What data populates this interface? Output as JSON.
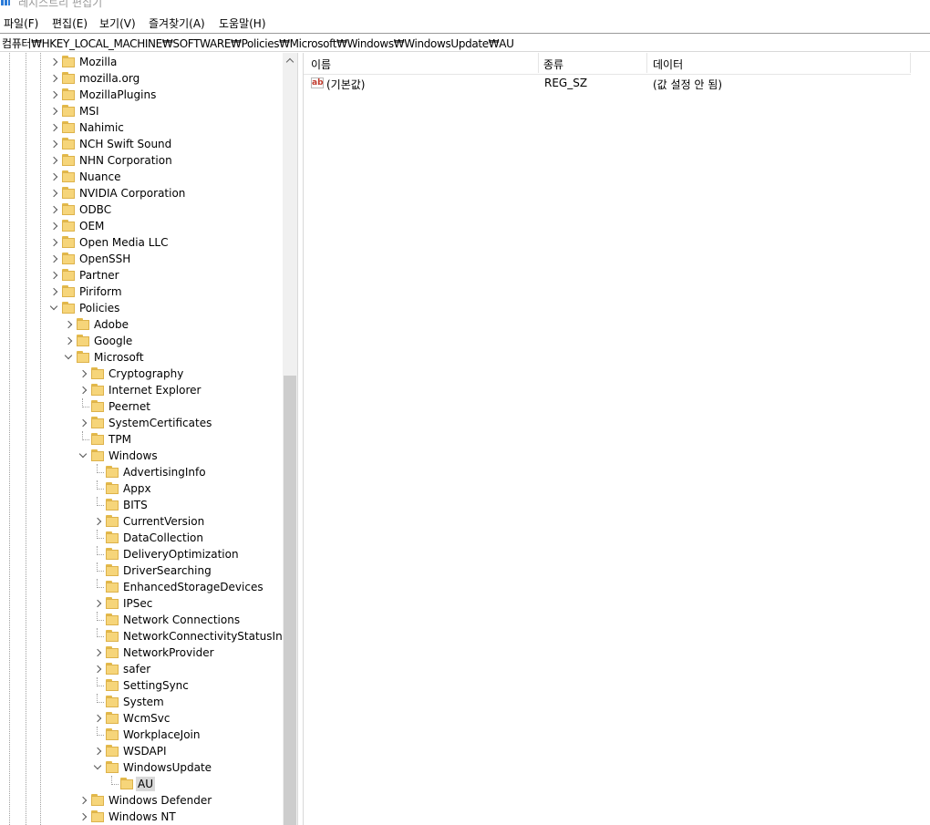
{
  "window": {
    "title": "레지스트리 편집기"
  },
  "menu": [
    {
      "label": "파일(F)"
    },
    {
      "label": "편집(E)"
    },
    {
      "label": "보기(V)"
    },
    {
      "label": "즐겨찾기(A)"
    },
    {
      "label": "도움말(H)"
    }
  ],
  "address": {
    "path": "컴퓨터₩HKEY_LOCAL_MACHINE₩SOFTWARE₩Policies₩Microsoft₩Windows₩WindowsUpdate₩AU"
  },
  "tree": {
    "items": [
      {
        "label": "Mozilla",
        "level": 0,
        "expander": "closed"
      },
      {
        "label": "mozilla.org",
        "level": 0,
        "expander": "closed"
      },
      {
        "label": "MozillaPlugins",
        "level": 0,
        "expander": "closed"
      },
      {
        "label": "MSI",
        "level": 0,
        "expander": "closed"
      },
      {
        "label": "Nahimic",
        "level": 0,
        "expander": "closed"
      },
      {
        "label": "NCH Swift Sound",
        "level": 0,
        "expander": "closed"
      },
      {
        "label": "NHN Corporation",
        "level": 0,
        "expander": "closed"
      },
      {
        "label": "Nuance",
        "level": 0,
        "expander": "closed"
      },
      {
        "label": "NVIDIA Corporation",
        "level": 0,
        "expander": "closed"
      },
      {
        "label": "ODBC",
        "level": 0,
        "expander": "closed"
      },
      {
        "label": "OEM",
        "level": 0,
        "expander": "closed"
      },
      {
        "label": "Open Media LLC",
        "level": 0,
        "expander": "closed"
      },
      {
        "label": "OpenSSH",
        "level": 0,
        "expander": "closed"
      },
      {
        "label": "Partner",
        "level": 0,
        "expander": "closed"
      },
      {
        "label": "Piriform",
        "level": 0,
        "expander": "closed"
      },
      {
        "label": "Policies",
        "level": 0,
        "expander": "open"
      },
      {
        "label": "Adobe",
        "level": 1,
        "expander": "closed"
      },
      {
        "label": "Google",
        "level": 1,
        "expander": "closed"
      },
      {
        "label": "Microsoft",
        "level": 1,
        "expander": "open"
      },
      {
        "label": "Cryptography",
        "level": 2,
        "expander": "closed"
      },
      {
        "label": "Internet Explorer",
        "level": 2,
        "expander": "closed"
      },
      {
        "label": "Peernet",
        "level": 2,
        "expander": "none"
      },
      {
        "label": "SystemCertificates",
        "level": 2,
        "expander": "closed"
      },
      {
        "label": "TPM",
        "level": 2,
        "expander": "none"
      },
      {
        "label": "Windows",
        "level": 2,
        "expander": "open"
      },
      {
        "label": "AdvertisingInfo",
        "level": 3,
        "expander": "none"
      },
      {
        "label": "Appx",
        "level": 3,
        "expander": "none"
      },
      {
        "label": "BITS",
        "level": 3,
        "expander": "none"
      },
      {
        "label": "CurrentVersion",
        "level": 3,
        "expander": "closed"
      },
      {
        "label": "DataCollection",
        "level": 3,
        "expander": "none"
      },
      {
        "label": "DeliveryOptimization",
        "level": 3,
        "expander": "none"
      },
      {
        "label": "DriverSearching",
        "level": 3,
        "expander": "none"
      },
      {
        "label": "EnhancedStorageDevices",
        "level": 3,
        "expander": "none"
      },
      {
        "label": "IPSec",
        "level": 3,
        "expander": "closed"
      },
      {
        "label": "Network Connections",
        "level": 3,
        "expander": "none"
      },
      {
        "label": "NetworkConnectivityStatusIndica",
        "level": 3,
        "expander": "none"
      },
      {
        "label": "NetworkProvider",
        "level": 3,
        "expander": "closed"
      },
      {
        "label": "safer",
        "level": 3,
        "expander": "closed"
      },
      {
        "label": "SettingSync",
        "level": 3,
        "expander": "none"
      },
      {
        "label": "System",
        "level": 3,
        "expander": "none"
      },
      {
        "label": "WcmSvc",
        "level": 3,
        "expander": "closed"
      },
      {
        "label": "WorkplaceJoin",
        "level": 3,
        "expander": "none"
      },
      {
        "label": "WSDAPI",
        "level": 3,
        "expander": "closed"
      },
      {
        "label": "WindowsUpdate",
        "level": 3,
        "expander": "open"
      },
      {
        "label": "AU",
        "level": 4,
        "expander": "none",
        "selected": true
      },
      {
        "label": "Windows Defender",
        "level": 2,
        "expander": "closed"
      },
      {
        "label": "Windows NT",
        "level": 2,
        "expander": "closed"
      }
    ]
  },
  "list": {
    "columns": [
      {
        "label": "이름"
      },
      {
        "label": "종류"
      },
      {
        "label": "데이터"
      }
    ],
    "rows": [
      {
        "name": "(기본값)",
        "type": "REG_SZ",
        "data": "(값 설정 안 됨)",
        "icon": "string-value-icon",
        "icon_text": "ab"
      }
    ]
  }
}
